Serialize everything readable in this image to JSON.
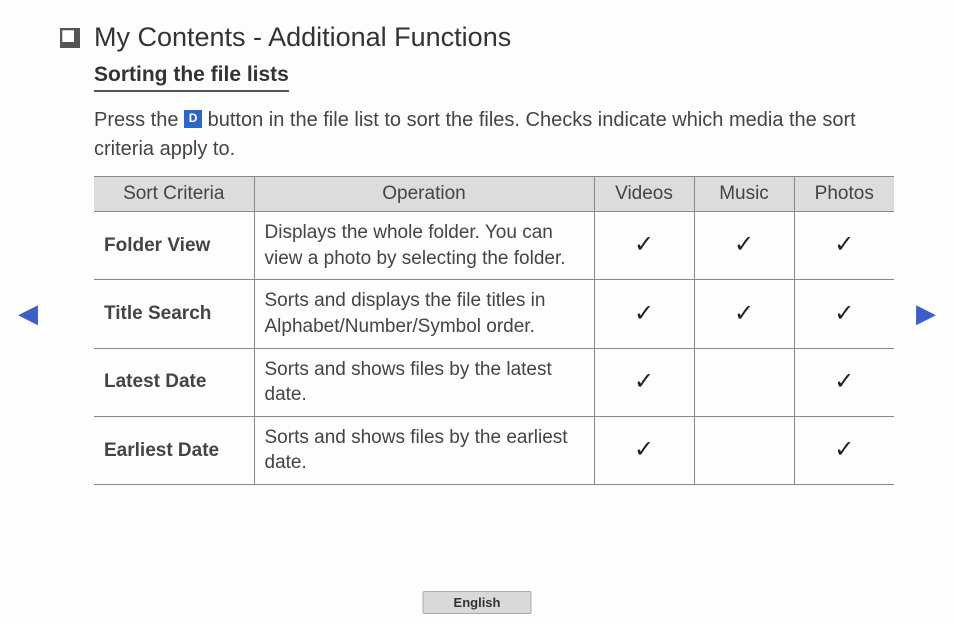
{
  "page": {
    "title": "My Contents - Additional Functions",
    "subtitle": "Sorting the file lists",
    "intro_part1": "Press the ",
    "d_button_label": "D",
    "intro_part2": " button in the file list to sort the files. Checks indicate which media the sort criteria apply to."
  },
  "table": {
    "headers": {
      "criteria": "Sort Criteria",
      "operation": "Operation",
      "videos": "Videos",
      "music": "Music",
      "photos": "Photos"
    },
    "rows": [
      {
        "criteria": "Folder View",
        "operation": "Displays the whole folder. You can view a photo by selecting the folder.",
        "videos": true,
        "music": true,
        "photos": true
      },
      {
        "criteria": "Title Search",
        "operation": "Sorts and displays the file titles in Alphabet/Number/Symbol order.",
        "videos": true,
        "music": true,
        "photos": true
      },
      {
        "criteria": "Latest Date",
        "operation": "Sorts and shows files by the latest date.",
        "videos": true,
        "music": false,
        "photos": true
      },
      {
        "criteria": "Earliest Date",
        "operation": "Sorts and shows files by the earliest date.",
        "videos": true,
        "music": false,
        "photos": true
      }
    ]
  },
  "nav": {
    "prev": "◀",
    "next": "▶"
  },
  "footer": {
    "language": "English"
  },
  "check_glyph": "✓"
}
